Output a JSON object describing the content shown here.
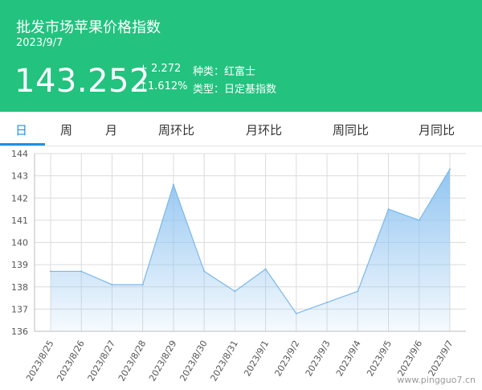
{
  "header": {
    "title": "批发市场苹果价格指数",
    "date": "2023/9/7",
    "price": "143.252",
    "change": "+ 2.272",
    "change_pct": "↑1.612%",
    "variety_label": "种类：红富士",
    "type_label": "类型：日定基指数"
  },
  "tabs": [
    {
      "label": "日"
    },
    {
      "label": "周"
    },
    {
      "label": "月"
    },
    {
      "label": "周环比"
    },
    {
      "label": "月环比"
    },
    {
      "label": "周同比"
    },
    {
      "label": "月同比"
    }
  ],
  "active_tab": 0,
  "colors": {
    "header_bg": "#23c27f",
    "accent": "#1e90e0",
    "line": "#7ab8ea",
    "fill": "#8cc2f0"
  },
  "watermark": "www.pingguo7.cn",
  "chart_data": {
    "type": "area",
    "x": [
      "2023/8/25",
      "2023/8/26",
      "2023/8/27",
      "2023/8/28",
      "2023/8/29",
      "2023/8/30",
      "2023/8/31",
      "2023/9/1",
      "2023/9/2",
      "2023/9/3",
      "2023/9/4",
      "2023/9/5",
      "2023/9/6",
      "2023/9/7"
    ],
    "values": [
      138.7,
      138.7,
      138.1,
      138.1,
      142.6,
      138.7,
      137.8,
      138.8,
      136.8,
      137.3,
      137.8,
      141.5,
      141.0,
      143.3
    ],
    "yticks": [
      136,
      137,
      138,
      139,
      140,
      141,
      142,
      143,
      144
    ],
    "ylim": [
      136,
      144
    ],
    "grid": true
  }
}
